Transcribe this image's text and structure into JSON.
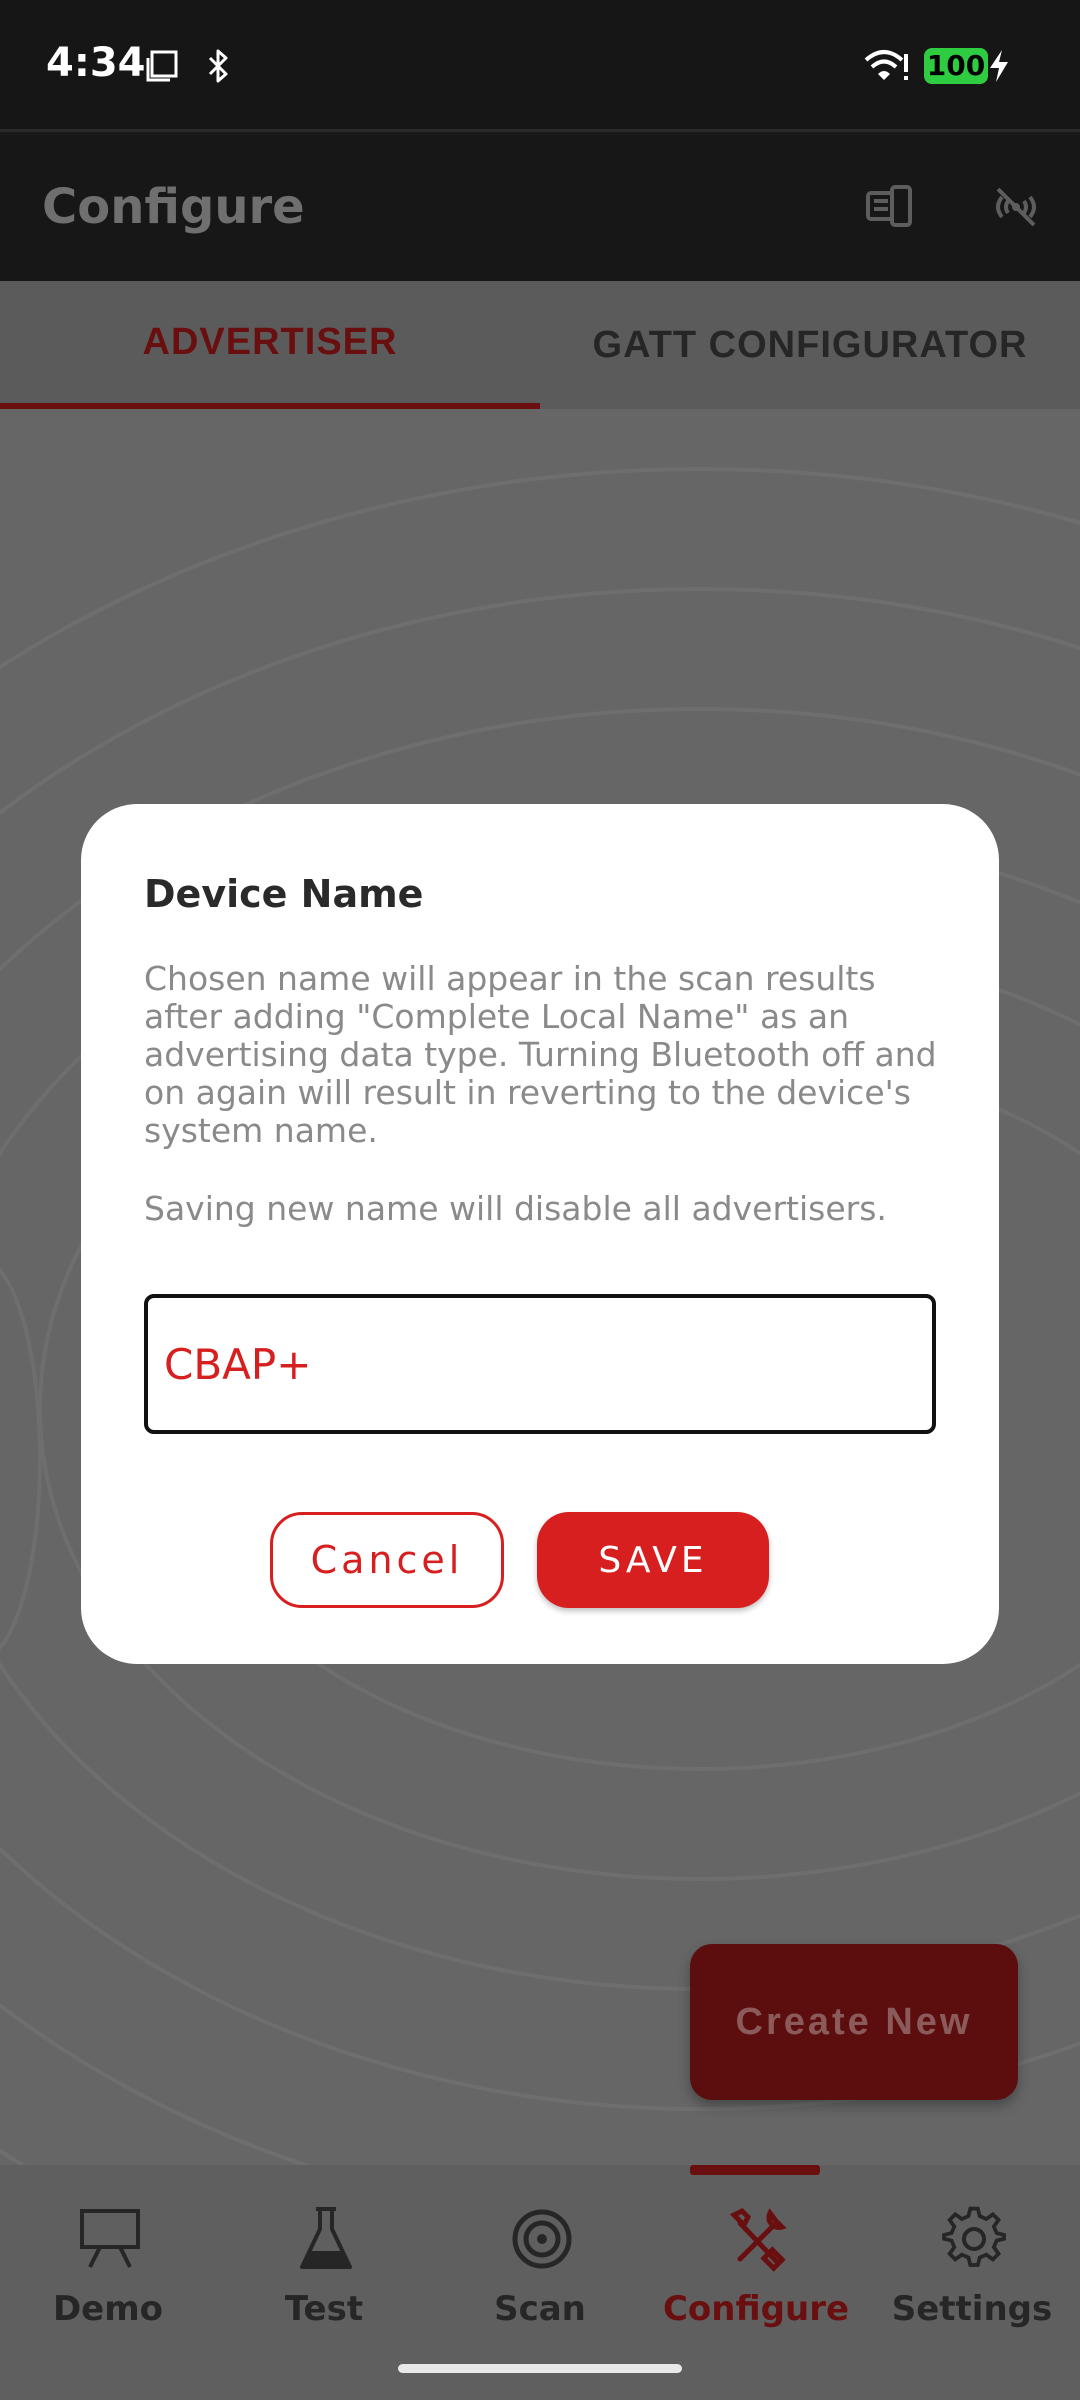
{
  "status_bar": {
    "time": "4:34",
    "battery": "100"
  },
  "app_bar": {
    "title": "Configure"
  },
  "tabs": [
    {
      "label": "ADVERTISER",
      "active": true
    },
    {
      "label": "GATT CONFIGURATOR",
      "active": false
    }
  ],
  "fab": {
    "label": "Create New"
  },
  "dialog": {
    "title": "Device Name",
    "body": "Chosen name will appear in the scan results after adding \"Complete Local Name\" as an advertising data type. Turning Bluetooth off and on again will result in reverting to the device's system name.",
    "note": "Saving new name will disable all advertisers.",
    "input_value": "CBAP+",
    "cancel_label": "Cancel",
    "save_label": "SAVE"
  },
  "bottom_nav": {
    "items": [
      {
        "label": "Demo",
        "icon": "presentation-board-icon"
      },
      {
        "label": "Test",
        "icon": "flask-icon"
      },
      {
        "label": "Scan",
        "icon": "target-icon"
      },
      {
        "label": "Configure",
        "icon": "tools-icon",
        "active": true
      },
      {
        "label": "Settings",
        "icon": "gear-icon"
      }
    ]
  },
  "colors": {
    "accent": "#d81f1f",
    "accent_dimmed": "#6a0f0f",
    "scrim": "#666666",
    "status_battery": "#2ecc40"
  }
}
